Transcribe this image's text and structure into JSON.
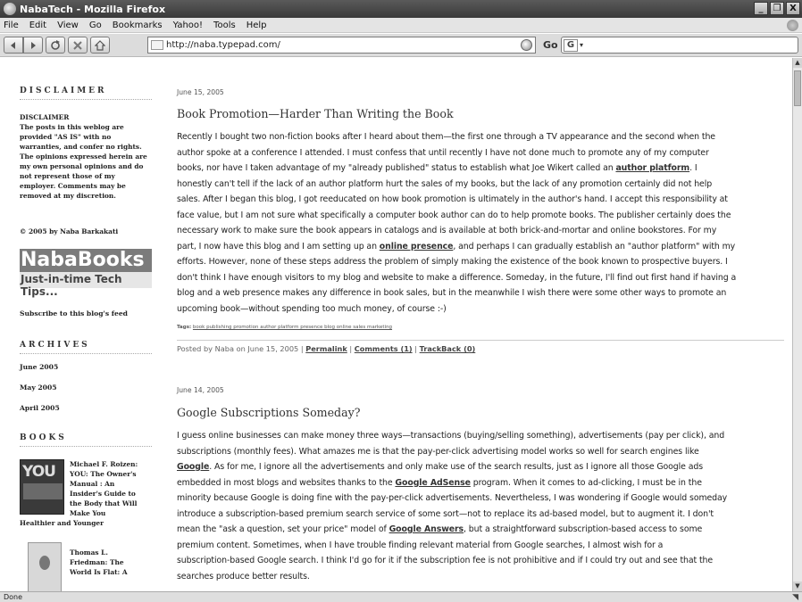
{
  "window": {
    "title": "NabaTech - Mozilla Firefox",
    "controls": [
      "_",
      "❐",
      "X"
    ]
  },
  "menu": [
    "File",
    "Edit",
    "View",
    "Go",
    "Bookmarks",
    "Yahoo!",
    "Tools",
    "Help"
  ],
  "toolbar": {
    "url": "http://naba.typepad.com/",
    "go_label": "Go",
    "search_engine": "G"
  },
  "sidebar": {
    "disclaimer_heading": "DISCLAIMER",
    "disclaimer_lines": [
      "DISCLAIMER",
      "The posts in this weblog are",
      "provided \"AS IS\" with no",
      "warranties, and confer no rights.",
      "The opinions expressed herein are",
      "my own personal opinions and do",
      "not represent those of my",
      "employer. Comments may be",
      "removed at my discretion."
    ],
    "copyright": "© 2005 by Naba Barkakati",
    "logo_title": "NabaBooks",
    "logo_tagline": "Just-in-time Tech Tips...",
    "subscribe": "Subscribe to this blog's feed",
    "archives_heading": "ARCHIVES",
    "archives": [
      "June 2005",
      "May 2005",
      "April 2005"
    ],
    "books_heading": "BOOKS",
    "book1": {
      "cover_text": "YOU",
      "lines": [
        "Michael F. Roizen:",
        "YOU: The Owner's",
        "Manual : An",
        "Insider's Guide to",
        "the Body that Will",
        "Make You"
      ],
      "last_line": "Healthier and Younger"
    },
    "book2": {
      "lines": [
        "Thomas L.",
        "Friedman: The",
        "World Is Flat: A"
      ]
    }
  },
  "posts": [
    {
      "date": "June 15, 2005",
      "title": "Book Promotion—Harder Than Writing the Book",
      "lines": [
        "Recently I bought two non-fiction books after I heard about them—the first one through a TV appearance and the second when the",
        "author spoke at a conference I attended. I must confess that until recently I have not done much to promote any of my computer",
        "books, nor have I taken advantage of my \"already published\" status to establish what Joe Wikert called an |author platform|. I",
        "honestly can't tell if the lack of an author platform hurt the sales of my books, but the lack of any promotion certainly did not help",
        "sales. After I began this blog, I got reeducated on how book promotion is ultimately in the author's hand. I accept this responsibility at",
        "face value, but I am not sure what specifically a computer book author can do to help promote books. The publisher certainly does the",
        "necessary work to make sure the book appears in catalogs and is available at both brick-and-mortar and online bookstores. For my",
        "part, I now have this blog and I am setting up an |online presence|, and perhaps I can gradually establish an \"author platform\" with my",
        "efforts. However, none of these steps address the problem of simply making the existence of the book known to prospective buyers. I",
        "don't think I have enough visitors to my blog and website to make a difference. Someday, in the future, I'll find out first hand if having a",
        "blog and a web presence makes any difference in book sales, but in the meanwhile I wish there were some other ways to promote an",
        "upcoming book—without spending too much money, of course :-)"
      ],
      "tags_label": "Tags:",
      "tags": "book publishing promotion author platform presence blog online sales marketing",
      "posted_by": "Posted by Naba on June 15, 2005 |",
      "permalink": "Permalink",
      "comments": "Comments (1)",
      "trackback": "TrackBack (0)"
    },
    {
      "date": "June 14, 2005",
      "title": "Google Subscriptions Someday?",
      "lines": [
        "I guess online businesses can make money three ways—transactions (buying/selling something), advertisements (pay per click), and",
        "subscriptions (monthly fees). What amazes me is that the pay-per-click advertising model works so well for search engines like",
        "|Google|. As for me, I ignore all the advertisements and only make use of the search results, just as I ignore all those Google ads",
        "embedded in most blogs and websites thanks to the |Google AdSense| program. When it comes to ad-clicking, I must be in the",
        "minority because Google is doing fine with the pay-per-click advertisements. Nevertheless, I was wondering if Google would someday",
        "introduce a subscription-based premium search service of some sort—not to replace its ad-based model, but to augment it. I don't",
        "mean the \"ask a question, set your price\" model of |Google Answers|, but a straightforward subscription-based access to some",
        "premium content. Sometimes, when I have trouble finding relevant material from Google searches, I almost wish for a",
        "subscription-based Google search. I think I'd go for it if the subscription fee is not prohibitive and if I could try out and see that the",
        "searches produce better results."
      ]
    }
  ],
  "status": {
    "text": "Done"
  }
}
